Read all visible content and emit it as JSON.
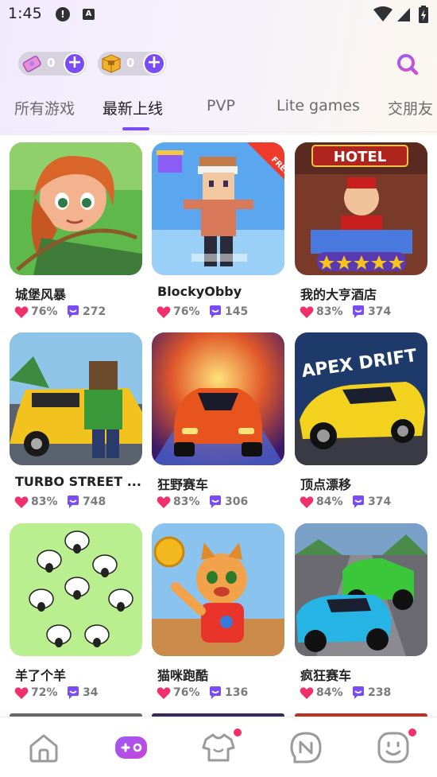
{
  "status_bar": {
    "time": "1:45",
    "alert_icon": "!",
    "a_icon": "A"
  },
  "currency": [
    {
      "name": "ticket",
      "value": "0"
    },
    {
      "name": "gold-box",
      "value": "0"
    }
  ],
  "tabs": [
    {
      "label": "所有游戏",
      "active": false
    },
    {
      "label": "最新上线",
      "active": true
    },
    {
      "label": "PVP",
      "active": false
    },
    {
      "label": "Lite games",
      "active": false
    },
    {
      "label": "交朋友",
      "active": false
    }
  ],
  "games": [
    {
      "name": "城堡风暴",
      "rating": "76%",
      "players": "272"
    },
    {
      "name": "BlockyObby",
      "rating": "76%",
      "players": "145",
      "thumb_text": "HOTEL"
    },
    {
      "name": "我的大亨酒店",
      "rating": "83%",
      "players": "374"
    },
    {
      "name": "TURBO STREET ...",
      "rating": "83%",
      "players": "748"
    },
    {
      "name": "狂野赛车",
      "rating": "83%",
      "players": "306"
    },
    {
      "name": "顶点漂移",
      "rating": "84%",
      "players": "374"
    },
    {
      "name": "羊了个羊",
      "rating": "72%",
      "players": "34"
    },
    {
      "name": "猫咪跑酷",
      "rating": "76%",
      "players": "136"
    },
    {
      "name": "疯狂赛车",
      "rating": "84%",
      "players": "238"
    }
  ],
  "thumb_text": {
    "free_suit": "FREE SUIT",
    "hotel": "HOTEL",
    "apex": "APEX DRIFT"
  },
  "nav": [
    {
      "name": "home",
      "active": false
    },
    {
      "name": "games",
      "active": true
    },
    {
      "name": "shop",
      "active": false,
      "badge": true
    },
    {
      "name": "news",
      "active": false
    },
    {
      "name": "profile",
      "active": false,
      "badge": true
    }
  ],
  "colors": {
    "accent": "#7a4cf6",
    "heart": "#f0306a",
    "badge": "#f0306a"
  }
}
